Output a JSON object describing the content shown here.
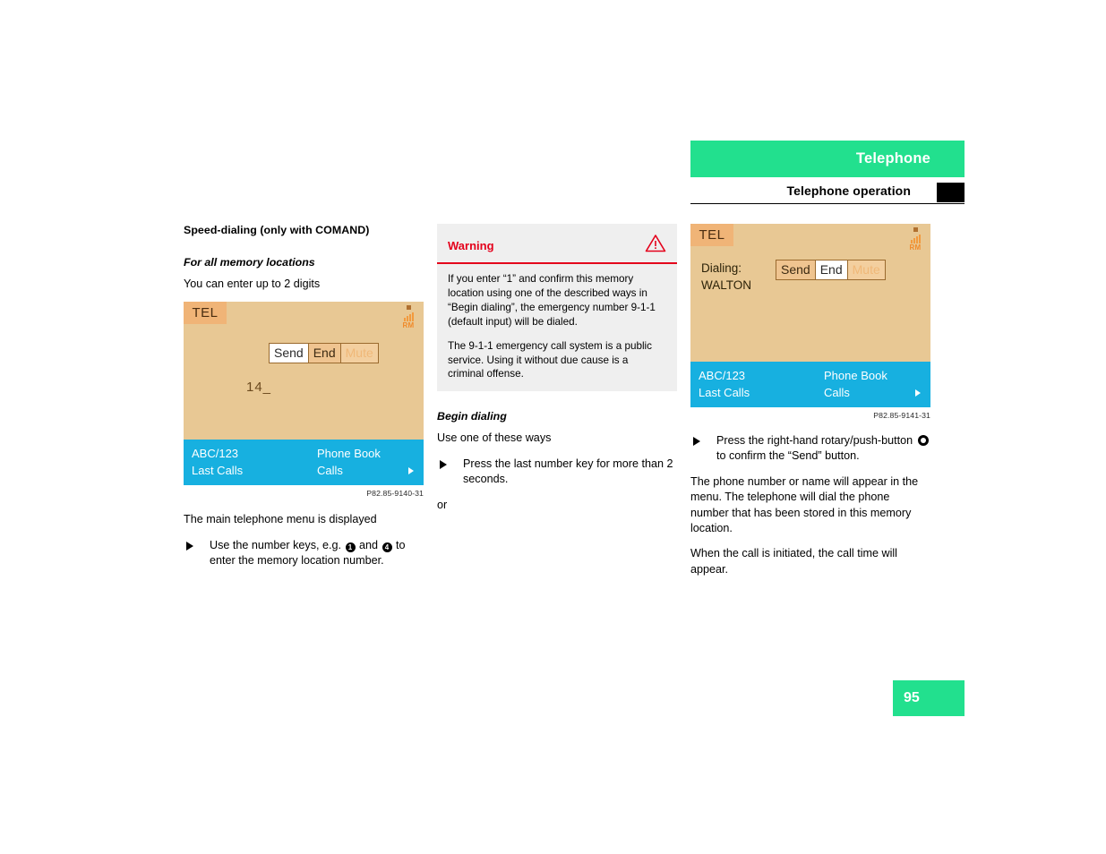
{
  "header": {
    "title": "Telephone",
    "subtitle": "Telephone operation",
    "accent_color": "#22e08e",
    "marker_color": "#000000"
  },
  "left_column": {
    "heading": "Speed-dialing (only with COMAND)",
    "subheading": "For all memory locations",
    "intro": "You can enter up to 2 digits",
    "figure": {
      "tel_label": "TEL",
      "roaming_label": "RM",
      "buttons": [
        {
          "label": "Send",
          "state": "selected"
        },
        {
          "label": "End",
          "state": "normal"
        },
        {
          "label": "Mute",
          "state": "dimmed"
        }
      ],
      "entry": "14_",
      "blue_bar": {
        "row1_left": "ABC/123",
        "row1_right": "Phone Book",
        "row2_left": "Last Calls",
        "row2_right": "Calls"
      },
      "caption": "P82.85-9140-31"
    },
    "after_figure": "The main telephone menu is displayed",
    "bullet": {
      "part1": "Use the number keys, e.g.",
      "key1": "1",
      "part2": "and",
      "key2": "4",
      "part3": "to enter the memory location number."
    }
  },
  "middle_column": {
    "warning": {
      "title": "Warning",
      "icon": "warning-triangle-icon",
      "accent_color": "#e4001b",
      "paragraphs": [
        "If you enter “1” and confirm this memory location using one of the described ways in “Begin dialing”, the emergency number 9-1-1 (default input) will be dialed.",
        "The 9-1-1 emergency call system is a public service. Using it without due cause is a criminal offense."
      ]
    },
    "subheading": "Begin dialing",
    "intro": "Use one of these ways",
    "bullet": "Press the last number key for more than 2 seconds.",
    "or_text": "or"
  },
  "right_column": {
    "figure": {
      "tel_label": "TEL",
      "roaming_label": "RM",
      "dialing_label": "Dialing:",
      "dialing_name": "WALTON",
      "buttons": [
        {
          "label": "Send",
          "state": "normal"
        },
        {
          "label": "End",
          "state": "selected"
        },
        {
          "label": "Mute",
          "state": "dimmed"
        }
      ],
      "blue_bar": {
        "row1_left": "ABC/123",
        "row1_right": "Phone Book",
        "row2_left": "Last Calls",
        "row2_right": "Calls"
      },
      "caption": "P82.85-9141-31"
    },
    "bullet": {
      "part1": "Press the right-hand rotary/push-button",
      "part2": "to confirm the “Send” button."
    },
    "paragraphs": [
      "The phone number or name will appear in the menu. The telephone will dial the phone number that has been stored in this memory location.",
      "When the call is initiated, the call time will appear."
    ]
  },
  "footer": {
    "page_number": "95"
  }
}
